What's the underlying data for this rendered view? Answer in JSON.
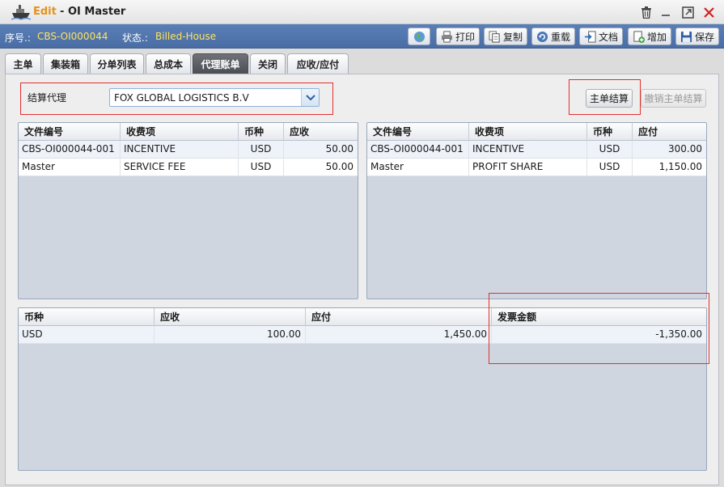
{
  "window": {
    "mode": "Edit",
    "separator": "-",
    "title": "OI Master"
  },
  "info": {
    "serial_label": "序号.:",
    "serial_value": "CBS-OI000044",
    "status_label": "状态.:",
    "status_value": "Billed-House"
  },
  "toolbar": {
    "print": "打印",
    "copy": "复制",
    "reload": "重载",
    "docs": "文档",
    "add": "增加",
    "save": "保存"
  },
  "tabs": [
    "主单",
    "集装箱",
    "分单列表",
    "总成本",
    "代理账单",
    "关闭",
    "应收/应付"
  ],
  "active_tab": "代理账单",
  "settlement": {
    "agent_label": "结算代理",
    "agent_value": "FOX GLOBAL LOGISTICS B.V",
    "master_settle": "主单结算",
    "cancel_master_settle": "撤销主单结算"
  },
  "receivable_grid": {
    "columns": [
      "文件编号",
      "收费项",
      "币种",
      "应收"
    ],
    "rows": [
      {
        "file_no": "CBS-OI000044-001",
        "charge": "INCENTIVE",
        "currency": "USD",
        "amount": "50.00"
      },
      {
        "file_no": "Master",
        "charge": "SERVICE FEE",
        "currency": "USD",
        "amount": "50.00"
      }
    ]
  },
  "payable_grid": {
    "columns": [
      "文件编号",
      "收费项",
      "币种",
      "应付"
    ],
    "rows": [
      {
        "file_no": "CBS-OI000044-001",
        "charge": "INCENTIVE",
        "currency": "USD",
        "amount": "300.00"
      },
      {
        "file_no": "Master",
        "charge": "PROFIT SHARE",
        "currency": "USD",
        "amount": "1,150.00"
      }
    ]
  },
  "summary_grid": {
    "columns": [
      "币种",
      "应收",
      "应付",
      "发票金额"
    ],
    "rows": [
      {
        "currency": "USD",
        "receivable": "100.00",
        "payable": "1,450.00",
        "invoice": "-1,350.00"
      }
    ]
  },
  "colors": {
    "title_accent": "#e8901a",
    "infobar_bg": "#4a6da6",
    "status_value": "#ffe45c",
    "highlight_box": "#e23030",
    "close_icon": "#d42020"
  }
}
